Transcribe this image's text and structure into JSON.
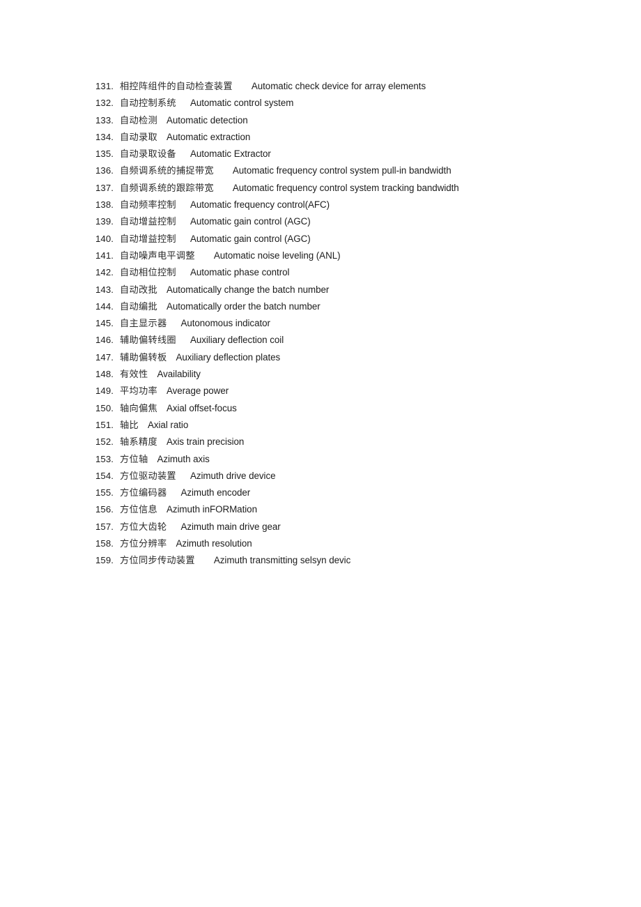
{
  "document": {
    "type": "glossary-page",
    "page_background": "#ffffff",
    "text_color": "#1c1c1c",
    "entries": [
      {
        "number": "131.",
        "chinese": "相控阵组件的自动检查装置",
        "english": "Automatic check device for array elements",
        "gap": "lg"
      },
      {
        "number": "132.",
        "chinese": "自动控制系统",
        "english": "Automatic control system",
        "gap": "md"
      },
      {
        "number": "133.",
        "chinese": "自动检测",
        "english": "Automatic detection",
        "gap": "sm"
      },
      {
        "number": "134.",
        "chinese": "自动录取",
        "english": "Automatic extraction",
        "gap": "sm"
      },
      {
        "number": "135.",
        "chinese": "自动录取设备",
        "english": "Automatic Extractor",
        "gap": "md"
      },
      {
        "number": "136.",
        "chinese": "自频调系统的捕捉带宽",
        "english": "Automatic frequency control system pull-in bandwidth",
        "gap": "lg"
      },
      {
        "number": "137.",
        "chinese": "自频调系统的跟踪带宽",
        "english": "Automatic frequency control system tracking bandwidth",
        "gap": "lg"
      },
      {
        "number": "138.",
        "chinese": "自动频率控制",
        "english": "Automatic frequency control(AFC)",
        "gap": "md"
      },
      {
        "number": "139.",
        "chinese": "自动增益控制",
        "english": "Automatic gain control (AGC)",
        "gap": "md"
      },
      {
        "number": "140.",
        "chinese": "自动增益控制",
        "english": "Automatic gain control (AGC)",
        "gap": "md"
      },
      {
        "number": "141.",
        "chinese": "自动噪声电平调整",
        "english": "Automatic noise leveling (ANL)",
        "gap": "lg"
      },
      {
        "number": "142.",
        "chinese": "自动相位控制",
        "english": "Automatic phase control",
        "gap": "md"
      },
      {
        "number": "143.",
        "chinese": "自动改批",
        "english": "Automatically change the batch number",
        "gap": "sm"
      },
      {
        "number": "144.",
        "chinese": "自动编批",
        "english": "Automatically order the batch number",
        "gap": "sm"
      },
      {
        "number": "145.",
        "chinese": "自主显示器",
        "english": "Autonomous indicator",
        "gap": "md"
      },
      {
        "number": "146.",
        "chinese": "辅助偏转线圈",
        "english": "Auxiliary deflection coil",
        "gap": "md"
      },
      {
        "number": "147.",
        "chinese": "辅助偏转板",
        "english": "Auxiliary deflection plates",
        "gap": "sm"
      },
      {
        "number": "148.",
        "chinese": "有效性",
        "english": "Availability",
        "gap": "sm"
      },
      {
        "number": "149.",
        "chinese": "平均功率",
        "english": "Average power",
        "gap": "sm"
      },
      {
        "number": "150.",
        "chinese": "轴向偏焦",
        "english": "Axial offset-focus",
        "gap": "sm"
      },
      {
        "number": "151.",
        "chinese": "轴比",
        "english": "Axial ratio",
        "gap": "sm"
      },
      {
        "number": "152.",
        "chinese": "轴系精度",
        "english": "Axis train precision",
        "gap": "sm"
      },
      {
        "number": "153.",
        "chinese": "方位轴",
        "english": "Azimuth axis",
        "gap": "sm"
      },
      {
        "number": "154.",
        "chinese": "方位驱动装置",
        "english": "Azimuth drive device",
        "gap": "md"
      },
      {
        "number": "155.",
        "chinese": "方位编码器",
        "english": "Azimuth encoder",
        "gap": "md"
      },
      {
        "number": "156.",
        "chinese": "方位信息",
        "english": "Azimuth inFORMation",
        "gap": "sm"
      },
      {
        "number": "157.",
        "chinese": "方位大齿轮",
        "english": "Azimuth main drive gear",
        "gap": "md"
      },
      {
        "number": "158.",
        "chinese": "方位分辨率",
        "english": "Azimuth resolution",
        "gap": "sm"
      },
      {
        "number": "159.",
        "chinese": "方位同步传动装置",
        "english": "Azimuth transmitting selsyn devic",
        "gap": "lg"
      }
    ]
  }
}
